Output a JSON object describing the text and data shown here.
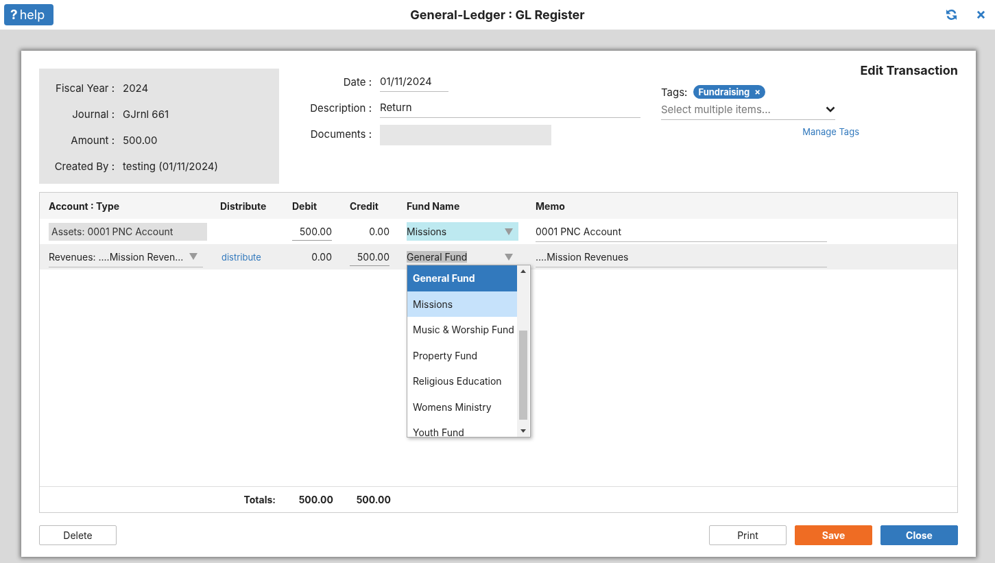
{
  "header": {
    "help_icon": "?",
    "help_label": "help",
    "title": "General-Ledger : GL Register"
  },
  "dialog": {
    "title": "Edit Transaction",
    "info": [
      {
        "label": "Fiscal Year :",
        "value": "2024"
      },
      {
        "label": "Journal :",
        "value": "GJrnl 661"
      },
      {
        "label": "Amount :",
        "value": "500.00"
      },
      {
        "label": "Created By :",
        "value": "testing (01/11/2024)"
      }
    ],
    "form": {
      "date": {
        "label": "Date :",
        "value": "01/11/2024"
      },
      "description": {
        "label": "Description :",
        "value": "Return"
      },
      "documents": {
        "label": "Documents :"
      }
    },
    "tags": {
      "label": "Tags:",
      "chips": [
        {
          "label": "Fundraising",
          "remove": "×"
        }
      ],
      "placeholder": "Select multiple items...",
      "manage_link": "Manage Tags"
    },
    "table": {
      "columns": [
        "Account : Type",
        "Distribute",
        "Debit",
        "Credit",
        "Fund Name",
        "Memo"
      ],
      "rows": [
        {
          "kind": "fixed",
          "selected": false,
          "account": "Assets: 0001 PNC Account",
          "debit": {
            "value": "500.00",
            "editable": true
          },
          "credit": {
            "value": "0.00",
            "editable": false
          },
          "fund": "Missions",
          "memo": "0001 PNC Account"
        },
        {
          "kind": "split",
          "selected": true,
          "account": "Revenues: ....Mission Reven...",
          "distribute": "distribute",
          "debit": {
            "value": "0.00",
            "editable": false
          },
          "credit": {
            "value": "500.00",
            "editable": true
          },
          "fund": "General Fund",
          "memo": "....Mission Revenues"
        }
      ],
      "totals": {
        "label": "Totals:",
        "debit": "500.00",
        "credit": "500.00"
      }
    },
    "fund_dropdown": {
      "items": [
        {
          "label": "General Fund",
          "selected": true,
          "highlighted": false
        },
        {
          "label": "Missions",
          "selected": false,
          "highlighted": true
        },
        {
          "label": "Music & Worship Fund",
          "selected": false,
          "highlighted": false
        },
        {
          "label": "Property Fund",
          "selected": false,
          "highlighted": false
        },
        {
          "label": "Religious Education",
          "selected": false,
          "highlighted": false
        },
        {
          "label": "Womens Ministry",
          "selected": false,
          "highlighted": false
        },
        {
          "label": "Youth Fund",
          "selected": false,
          "highlighted": false
        }
      ]
    },
    "buttons": [
      {
        "label": "Delete",
        "kind": "plain"
      },
      {
        "label": "Print",
        "kind": "plain"
      },
      {
        "label": "Save",
        "kind": "warning"
      },
      {
        "label": "Close",
        "kind": "primary"
      }
    ]
  }
}
